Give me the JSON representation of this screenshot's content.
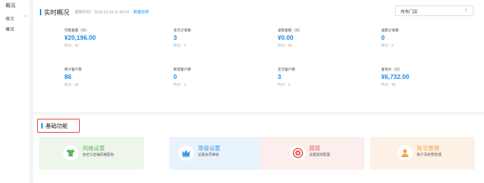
{
  "sidebar": {
    "top_item": "概况",
    "group_label": "概况",
    "group_chevron": "^",
    "item": "概况"
  },
  "overview": {
    "title": "实时概况",
    "update_time": "更新时间：2019.10.24 11:39:31",
    "desc_link": "数据说明",
    "store_select": {
      "value": "所有门店",
      "caret": "v"
    },
    "stats": [
      {
        "label": "付款金额（元）",
        "value": "¥20,196.00",
        "yesterday": "昨日：¥0"
      },
      {
        "label": "支付订单数",
        "value": "3",
        "yesterday": "昨日：0"
      },
      {
        "label": "退款金额（元）",
        "value": "¥0.00",
        "yesterday": "昨日：¥0"
      },
      {
        "label": "退款订单数",
        "value": "0",
        "yesterday": "昨日：0"
      },
      {
        "label": "累计客户数",
        "value": "86",
        "yesterday": "昨日：86"
      },
      {
        "label": "新增客户数",
        "value": "0",
        "yesterday": "昨日：3"
      },
      {
        "label": "支付客户数",
        "value": "3",
        "yesterday": "昨日：0"
      },
      {
        "label": "客单价（元）",
        "value": "¥6,732.00",
        "yesterday": "昨日：¥0"
      }
    ]
  },
  "functions": {
    "title": "基础功能",
    "cards": [
      {
        "name": "风格设置",
        "desc": "自定义店铺风格配色",
        "icon": "tshirt-icon",
        "color": "#5db55a"
      },
      {
        "name": "等级设置",
        "desc": "设置会员等级",
        "icon": "crown-icon",
        "color": "#3b9be8"
      },
      {
        "name": "提现",
        "desc": "设置提现配置",
        "icon": "withdraw-icon",
        "color": "#ea5455"
      },
      {
        "name": "账号管理",
        "desc": "账户及权限管理",
        "icon": "account-icon",
        "color": "#f0a54b"
      }
    ]
  },
  "colors": {
    "accent": "#1890ff",
    "value": "#1f8be8",
    "highlight_border": "#e4393c"
  }
}
